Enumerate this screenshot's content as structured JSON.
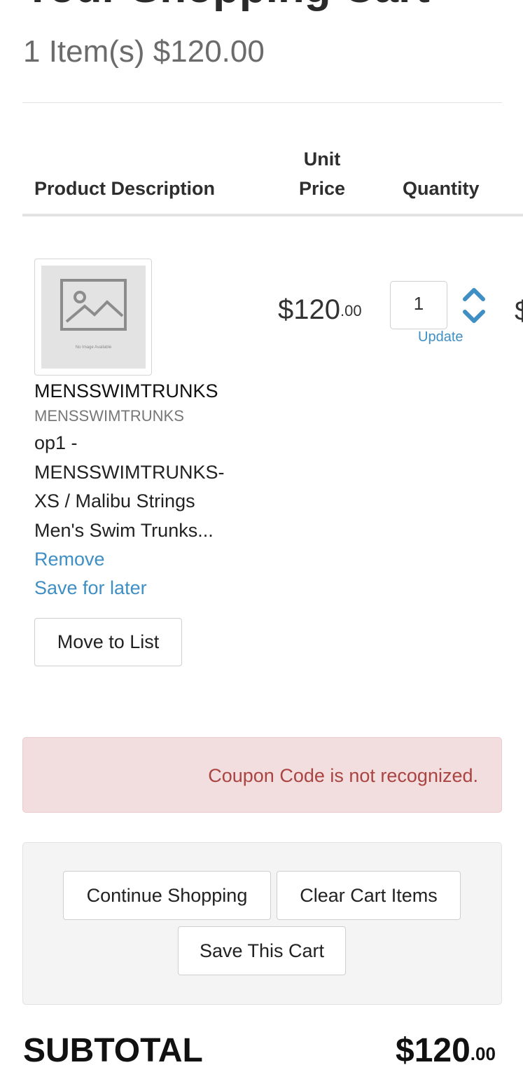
{
  "page": {
    "title": "Your Shopping Cart",
    "summary": "1 Item(s) $120.00"
  },
  "table": {
    "columns": {
      "product": "Product Description",
      "unit_price": "Unit\nPrice",
      "quantity": "Quantity"
    }
  },
  "item": {
    "image_caption": "No Image Available",
    "name": "MENSSWIMTRUNKS",
    "sku": "MENSSWIMTRUNKS",
    "description": "op1 - MENSSWIMTRUNKS- XS / Malibu Strings Men's Swim Trunks...",
    "remove_label": "Remove",
    "save_later_label": "Save for later",
    "move_to_list_label": "Move to List",
    "unit_price_main": "$120",
    "unit_price_cents": ".00",
    "quantity": "1",
    "update_label": "Update",
    "line_total_clipped": "$"
  },
  "alert": {
    "message": "Coupon Code is not recognized."
  },
  "actions": {
    "continue_label": "Continue Shopping",
    "clear_label": "Clear Cart Items",
    "save_cart_label": "Save This Cart"
  },
  "subtotal": {
    "label": "SUBTOTAL",
    "value_main": "$120",
    "value_cents": ".00"
  },
  "colors": {
    "link": "#3f8fc4",
    "alert_bg": "#f2dede",
    "alert_text": "#a94442"
  }
}
